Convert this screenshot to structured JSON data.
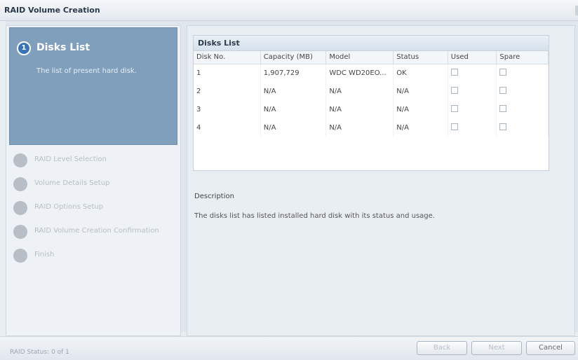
{
  "window": {
    "title": "RAID Volume Creation"
  },
  "steps": {
    "active": {
      "number": "1",
      "title": "Disks List",
      "description": "The list of present hard disk."
    },
    "items": [
      {
        "label": "RAID Level Selection"
      },
      {
        "label": "Volume Details Setup"
      },
      {
        "label": "RAID Options Setup"
      },
      {
        "label": "RAID Volume Creation Confirmation"
      },
      {
        "label": "Finish"
      }
    ]
  },
  "disks_list": {
    "title": "Disks List",
    "columns": [
      "Disk No.",
      "Capacity (MB)",
      "Model",
      "Status",
      "Used",
      "Spare"
    ],
    "rows": [
      {
        "disk_no": "1",
        "capacity": "1,907,729",
        "model": "WDC WD20EO...",
        "status": "OK"
      },
      {
        "disk_no": "2",
        "capacity": "N/A",
        "model": "N/A",
        "status": "N/A"
      },
      {
        "disk_no": "3",
        "capacity": "N/A",
        "model": "N/A",
        "status": "N/A"
      },
      {
        "disk_no": "4",
        "capacity": "N/A",
        "model": "N/A",
        "status": "N/A"
      }
    ]
  },
  "description": {
    "label": "Description",
    "text": "The disks list has listed installed hard disk with its status and usage."
  },
  "footer": {
    "status_text": "RAID Status: 0 of 1",
    "buttons": {
      "back": "Back",
      "next": "Next",
      "cancel": "Cancel"
    }
  }
}
